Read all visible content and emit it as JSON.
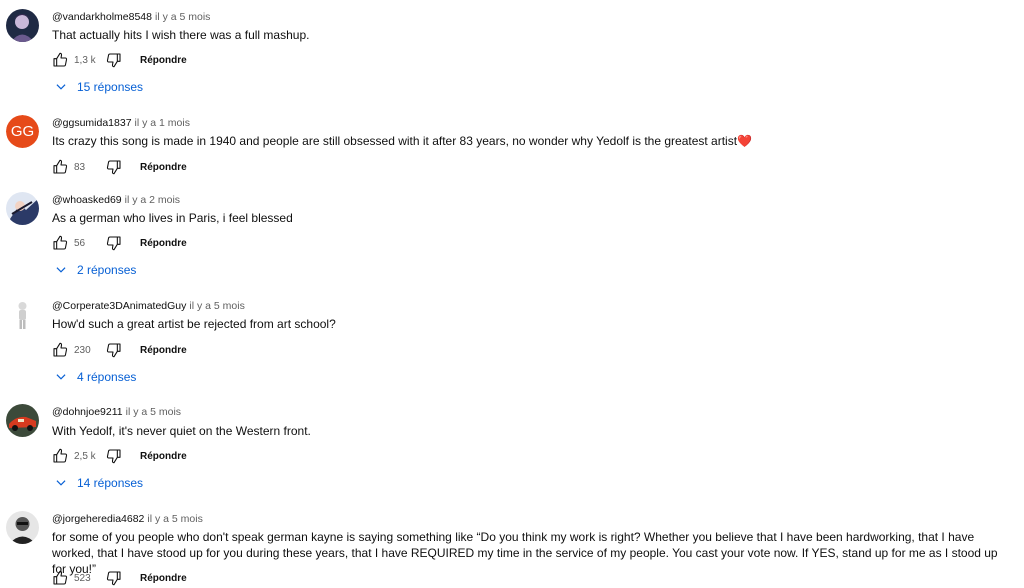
{
  "comments": [
    {
      "author": "@vandarkholme8548",
      "time": "il y a 5 mois",
      "text": "That actually hits I wish there was a full mashup.",
      "likes": "1,3 k",
      "reply_label": "Répondre",
      "replies_label": "15 réponses",
      "avatar_icon": "dark-anime-avatar"
    },
    {
      "author": "@ggsumida1837",
      "time": "il y a 1 mois",
      "text": "Its crazy this song is made in 1940 and people are still obsessed with it after 83 years, no wonder why Yedolf is the greatest artist",
      "emoji": "❤️",
      "likes": "83",
      "reply_label": "Répondre",
      "avatar_initials": "GG",
      "avatar_color": "#e64a19"
    },
    {
      "author": "@whoasked69",
      "time": "il y a 2 mois",
      "text": "As a german who lives in Paris, i feel blessed",
      "likes": "56",
      "reply_label": "Répondre",
      "replies_label": "2 réponses",
      "avatar_icon": "anime-character-avatar"
    },
    {
      "author": "@Corperate3DAnimatedGuy",
      "time": "il y a 5 mois",
      "text": "How'd such a great artist be rejected from art school?",
      "likes": "230",
      "reply_label": "Répondre",
      "replies_label": "4 réponses",
      "avatar_icon": "3d-figure-avatar"
    },
    {
      "author": "@dohnjoe9211",
      "time": "il y a 5 mois",
      "text": "With Yedolf, it's never quiet on the Western front.",
      "likes": "2,5 k",
      "reply_label": "Répondre",
      "replies_label": "14 réponses",
      "avatar_icon": "race-car-avatar"
    },
    {
      "author": "@jorgeheredia4682",
      "time": "il y a 5 mois",
      "text": "for some of you people who don't speak german kayne is saying something like “Do you think my work is right?  Whether you believe that I have been hardworking, that I have worked, that I have stood up for you during these years, that I have REQUIRED my time in the service of my people.  You cast your vote now.  If YES, stand up for me as I stood up for you!”",
      "likes": "523",
      "reply_label": "Répondre",
      "avatar_icon": "portrait-avatar"
    }
  ],
  "colors": {
    "link": "#065fd4",
    "secondary_text": "#606060",
    "heart": "#e8212e"
  }
}
